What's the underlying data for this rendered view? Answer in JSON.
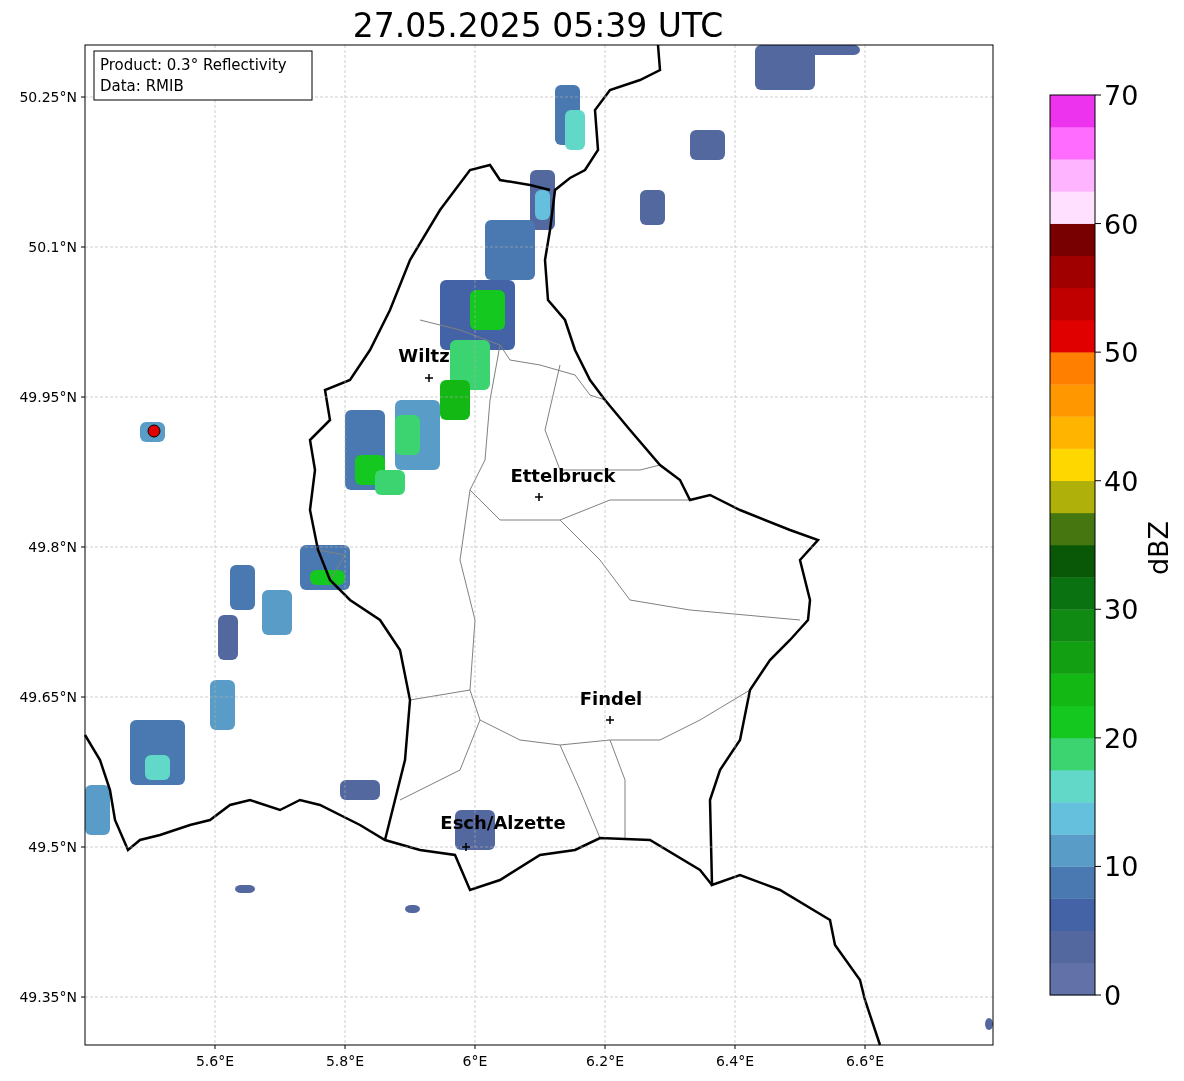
{
  "title": "27.05.2025 05:39 UTC",
  "info_box": [
    "Product: 0.3° Reflectivity",
    "Data: RMIB"
  ],
  "cities": [
    {
      "name": "Wiltz"
    },
    {
      "name": "Ettelbruck"
    },
    {
      "name": "Findel"
    },
    {
      "name": "Esch/Alzette"
    }
  ],
  "lat_ticks": [
    "50.25°N",
    "50.1°N",
    "49.95°N",
    "49.8°N",
    "49.65°N",
    "49.5°N",
    "49.35°N"
  ],
  "lon_ticks": [
    "5.6°E",
    "5.8°E",
    "6°E",
    "6.2°E",
    "6.4°E",
    "6.6°E"
  ],
  "colorbar": {
    "label": "dBZ",
    "ticks": [
      "70",
      "60",
      "50",
      "40",
      "30",
      "20",
      "10",
      "0"
    ],
    "segments": [
      {
        "color": "#6272a8"
      },
      {
        "color": "#5468a0"
      },
      {
        "color": "#4462a6"
      },
      {
        "color": "#4a78b0"
      },
      {
        "color": "#5a9cc8"
      },
      {
        "color": "#64c0dc"
      },
      {
        "color": "#62d8c8"
      },
      {
        "color": "#3cd470"
      },
      {
        "color": "#14c820"
      },
      {
        "color": "#14b814"
      },
      {
        "color": "#12a012"
      },
      {
        "color": "#108a12"
      },
      {
        "color": "#0a7210"
      },
      {
        "color": "#085808"
      },
      {
        "color": "#467610"
      },
      {
        "color": "#b0b00a"
      },
      {
        "color": "#ffd700"
      },
      {
        "color": "#ffb400"
      },
      {
        "color": "#ff9800"
      },
      {
        "color": "#ff7f00"
      },
      {
        "color": "#e00000"
      },
      {
        "color": "#c00000"
      },
      {
        "color": "#a00000"
      },
      {
        "color": "#780000"
      },
      {
        "color": "#ffe0ff"
      },
      {
        "color": "#ffb4ff"
      },
      {
        "color": "#ff6cff"
      },
      {
        "color": "#ee33ee"
      }
    ]
  }
}
